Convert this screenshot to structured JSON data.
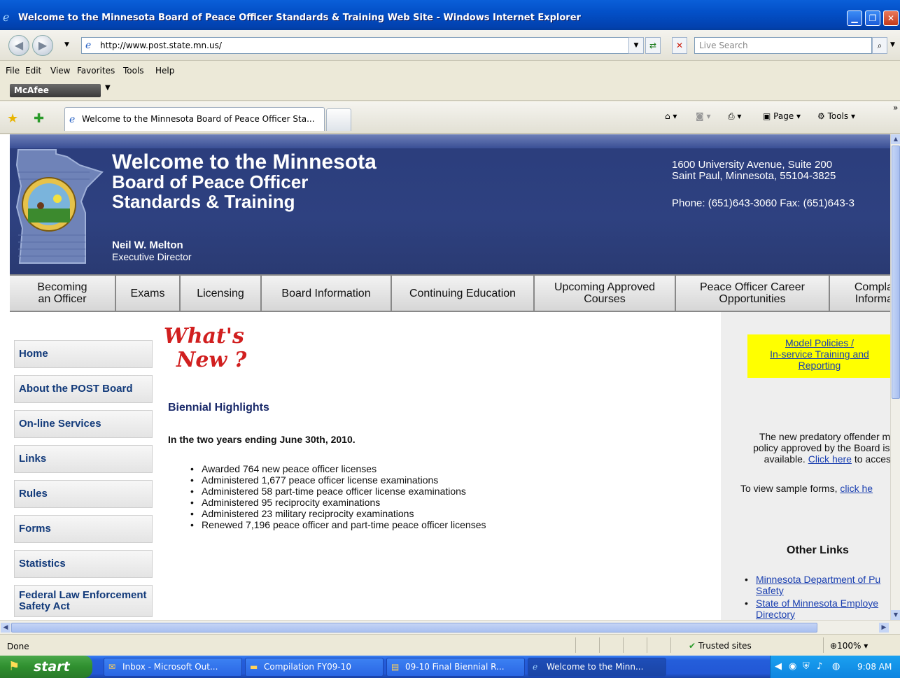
{
  "window": {
    "title": "Welcome to the Minnesota Board of Peace Officer Standards & Training Web Site - Windows Internet Explorer",
    "minimize_glyph": "▁",
    "maximize_glyph": "❐",
    "close_glyph": "✕"
  },
  "address_bar": {
    "url": "http://www.post.state.mn.us/",
    "search_placeholder": "Live Search"
  },
  "menu": [
    "File",
    "Edit",
    "View",
    "Favorites",
    "Tools",
    "Help"
  ],
  "toolbar": {
    "mcafee_label": "McAfee"
  },
  "tab": {
    "title": "Welcome to the Minnesota Board of Peace Officer Sta...",
    "page_label": "Page",
    "tools_label": "Tools"
  },
  "header": {
    "title_line1": "Welcome to the Minnesota",
    "title_line2": "Board of Peace Officer",
    "title_line3": "Standards & Training",
    "director_name": "Neil W. Melton",
    "director_title": "Executive Director",
    "address_line1": "1600 University Avenue, Suite 200",
    "address_line2": "Saint Paul, Minnesota, 55104-3825",
    "phone_fax": "Phone: (651)643-3060 Fax: (651)643-3"
  },
  "nav": [
    {
      "line1": "Becoming",
      "line2": "an Officer"
    },
    {
      "line1": "Exams",
      "line2": ""
    },
    {
      "line1": "Licensing",
      "line2": ""
    },
    {
      "line1": "Board Information",
      "line2": ""
    },
    {
      "line1": "Continuing Education",
      "line2": ""
    },
    {
      "line1": "Upcoming Approved",
      "line2": "Courses"
    },
    {
      "line1": "Peace Officer Career",
      "line2": "Opportunities"
    },
    {
      "line1": "Compla",
      "line2": "Informa"
    }
  ],
  "sidebar": [
    {
      "line1": "Home",
      "line2": ""
    },
    {
      "line1": "About the POST Board",
      "line2": ""
    },
    {
      "line1": "On-line Services",
      "line2": ""
    },
    {
      "line1": "Links",
      "line2": ""
    },
    {
      "line1": "Rules",
      "line2": ""
    },
    {
      "line1": "Forms",
      "line2": ""
    },
    {
      "line1": "Statistics",
      "line2": ""
    },
    {
      "line1": "Federal Law Enforcement",
      "line2": "Safety Act"
    }
  ],
  "main": {
    "whats_line1": "What's",
    "whats_line2": "New ?",
    "section_title": "Biennial Highlights",
    "period": "In the two years ending June 30th, 2010.",
    "highlights": [
      "Awarded 764 new peace officer licenses",
      "Administered 1,677 peace officer license examinations",
      "Administered 58 part-time peace officer license examinations",
      "Administered 95 reciprocity examinations",
      "Administered 23 military reciprocity examinations",
      "Renewed 7,196 peace officer and part-time peace officer licenses"
    ]
  },
  "right": {
    "model_line1": "Model Policies /",
    "model_line2": "In-service Training and",
    "model_line3": "Reporting",
    "pred_line1": "The new predatory offender mo",
    "pred_line2": "policy approved by the Board is r",
    "pred_line3_pre": "available.",
    "pred_link": "Click here",
    "pred_line3_post": "to access",
    "sample_pre": "To view sample forms,",
    "sample_link": "click he",
    "other_title": "Other Links",
    "other_links": [
      {
        "line1": "Minnesota Department of Pu",
        "line2": "Safety"
      },
      {
        "line1": "State of Minnesota Employe",
        "line2": "Directory"
      }
    ]
  },
  "status": {
    "text": "Done",
    "zone": "Trusted sites",
    "zoom": "100%"
  },
  "taskbar": {
    "start": "start",
    "tasks": [
      "Inbox - Microsoft Out...",
      "Compilation FY09-10",
      "09-10 Final Biennial R...",
      "Welcome to the Minn..."
    ],
    "clock": "9:08 AM"
  },
  "colors": {
    "header_blue": "#2e4180",
    "whats_new_red": "#d11f1f",
    "link_blue": "#1a3fb0",
    "highlight_yellow": "#ffff00"
  }
}
